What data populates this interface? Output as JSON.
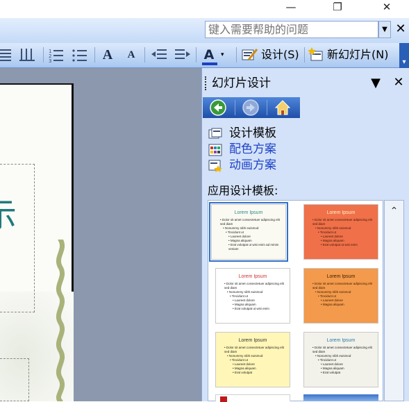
{
  "window": {
    "minimize_glyph": "—",
    "restore_glyph": "❐",
    "close_glyph": "✕"
  },
  "help": {
    "placeholder": "键入需要帮助的问题",
    "dropdown_glyph": "▼",
    "close_glyph": "✕"
  },
  "toolbar": {
    "icons": [
      "align-icon",
      "column-icon",
      "numbered-list-icon",
      "bulleted-list-icon",
      "increase-font-icon",
      "decrease-font-icon",
      "decrease-indent-icon",
      "increase-indent-icon",
      "font-color-icon",
      "design-icon",
      "new-slide-icon"
    ],
    "font_color_glyph": "A",
    "increase_font_glyph": "A",
    "decrease_font_glyph": "A",
    "design_label": "设计(S)",
    "new_slide_label": "新幻灯片(N)",
    "overflow_glyph": "▾"
  },
  "slide": {
    "partial_char": "示"
  },
  "pane": {
    "title": "幻灯片设计",
    "dropdown_glyph": "▼",
    "close_glyph": "✕",
    "nav": {
      "back_icon": "back-arrow-icon",
      "forward_icon": "forward-arrow-icon",
      "home_icon": "home-icon"
    },
    "links": [
      {
        "label": "设计模板",
        "icon": "design-template-icon",
        "color": "#000000"
      },
      {
        "label": "配色方案",
        "icon": "color-scheme-icon",
        "color": "#1f44c8"
      },
      {
        "label": "动画方案",
        "icon": "animation-scheme-icon",
        "color": "#1f44c8"
      }
    ],
    "apply_label": "应用设计模板:",
    "scroll_up_glyph": "⌃",
    "templates": [
      {
        "title": "Lorem Ipsum",
        "bullets": [
          "Dolor sit amet consectetuer adipiscing elit sed diam",
          "Nonummy nibh euismod",
          "Tincidunt ut",
          "Laoreet dolore",
          "Magna aliquam",
          "Erat volutpat ut wisi enim ad minim veniam"
        ],
        "bg": "#fbfaf2",
        "title_color": "#2e8a8a",
        "selected": true
      },
      {
        "title": "Lorem Ipsum",
        "bullets": [
          "Dolor sit amet consectetuer adipiscing elit sed diam",
          "Nonummy nibh euismod",
          "Tincidunt ut",
          "Laoreet dolore",
          "Magna aliquam",
          "Erat volutpat ut wisi enim"
        ],
        "bg": "#f0704a",
        "title_color": "#fff6cc",
        "selected": false
      },
      {
        "title": "Lorem Ipsum",
        "bullets": [
          "Dolor sit amet consectetuer adipiscing elit sed diam",
          "Nonummy nibh euismod",
          "Tincidunt ut",
          "Laoreet dolore",
          "Magna aliquam",
          "Erat volutpat ut wisi enim"
        ],
        "bg": "#ffffff",
        "title_color": "#d03030",
        "selected": false
      },
      {
        "title": "Lorem Ipsum",
        "bullets": [
          "Dolor sit amet consectetuer adipiscing elit sed diam",
          "Nonummy nibh euismod",
          "Tincidunt ut",
          "Laoreet dolore",
          "Magna aliquam"
        ],
        "bg": "#f39a4c",
        "title_color": "#3a1f00",
        "selected": false
      },
      {
        "title": "Lorem Ipsum",
        "bullets": [
          "Dolor sit amet consectetuer adipiscing elit sed diam",
          "Nonummy nibh euismod",
          "Tincidunt ut",
          "Laoreet dolore",
          "Magna aliquam",
          "Erat volutpat"
        ],
        "bg": "#fff6b8",
        "title_color": "#333333",
        "selected": false
      },
      {
        "title": "Lorem Ipsum",
        "bullets": [
          "Dolor sit amet consectetuer adipiscing elit sed diam",
          "Nonummy nibh euismod",
          "Tincidunt ut",
          "Laoreet dolore",
          "Magna aliquam",
          "Erat volutpat"
        ],
        "bg": "#f2f2ea",
        "title_color": "#2a7aa8",
        "selected": false
      }
    ]
  }
}
